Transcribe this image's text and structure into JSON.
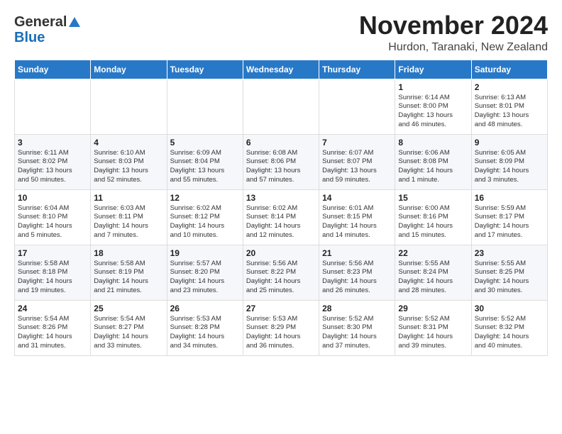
{
  "header": {
    "logo_general": "General",
    "logo_blue": "Blue",
    "month_title": "November 2024",
    "location": "Hurdon, Taranaki, New Zealand"
  },
  "days_of_week": [
    "Sunday",
    "Monday",
    "Tuesday",
    "Wednesday",
    "Thursday",
    "Friday",
    "Saturday"
  ],
  "weeks": [
    [
      {
        "day": "",
        "content": ""
      },
      {
        "day": "",
        "content": ""
      },
      {
        "day": "",
        "content": ""
      },
      {
        "day": "",
        "content": ""
      },
      {
        "day": "",
        "content": ""
      },
      {
        "day": "1",
        "content": "Sunrise: 6:14 AM\nSunset: 8:00 PM\nDaylight: 13 hours\nand 46 minutes."
      },
      {
        "day": "2",
        "content": "Sunrise: 6:13 AM\nSunset: 8:01 PM\nDaylight: 13 hours\nand 48 minutes."
      }
    ],
    [
      {
        "day": "3",
        "content": "Sunrise: 6:11 AM\nSunset: 8:02 PM\nDaylight: 13 hours\nand 50 minutes."
      },
      {
        "day": "4",
        "content": "Sunrise: 6:10 AM\nSunset: 8:03 PM\nDaylight: 13 hours\nand 52 minutes."
      },
      {
        "day": "5",
        "content": "Sunrise: 6:09 AM\nSunset: 8:04 PM\nDaylight: 13 hours\nand 55 minutes."
      },
      {
        "day": "6",
        "content": "Sunrise: 6:08 AM\nSunset: 8:06 PM\nDaylight: 13 hours\nand 57 minutes."
      },
      {
        "day": "7",
        "content": "Sunrise: 6:07 AM\nSunset: 8:07 PM\nDaylight: 13 hours\nand 59 minutes."
      },
      {
        "day": "8",
        "content": "Sunrise: 6:06 AM\nSunset: 8:08 PM\nDaylight: 14 hours\nand 1 minute."
      },
      {
        "day": "9",
        "content": "Sunrise: 6:05 AM\nSunset: 8:09 PM\nDaylight: 14 hours\nand 3 minutes."
      }
    ],
    [
      {
        "day": "10",
        "content": "Sunrise: 6:04 AM\nSunset: 8:10 PM\nDaylight: 14 hours\nand 5 minutes."
      },
      {
        "day": "11",
        "content": "Sunrise: 6:03 AM\nSunset: 8:11 PM\nDaylight: 14 hours\nand 7 minutes."
      },
      {
        "day": "12",
        "content": "Sunrise: 6:02 AM\nSunset: 8:12 PM\nDaylight: 14 hours\nand 10 minutes."
      },
      {
        "day": "13",
        "content": "Sunrise: 6:02 AM\nSunset: 8:14 PM\nDaylight: 14 hours\nand 12 minutes."
      },
      {
        "day": "14",
        "content": "Sunrise: 6:01 AM\nSunset: 8:15 PM\nDaylight: 14 hours\nand 14 minutes."
      },
      {
        "day": "15",
        "content": "Sunrise: 6:00 AM\nSunset: 8:16 PM\nDaylight: 14 hours\nand 15 minutes."
      },
      {
        "day": "16",
        "content": "Sunrise: 5:59 AM\nSunset: 8:17 PM\nDaylight: 14 hours\nand 17 minutes."
      }
    ],
    [
      {
        "day": "17",
        "content": "Sunrise: 5:58 AM\nSunset: 8:18 PM\nDaylight: 14 hours\nand 19 minutes."
      },
      {
        "day": "18",
        "content": "Sunrise: 5:58 AM\nSunset: 8:19 PM\nDaylight: 14 hours\nand 21 minutes."
      },
      {
        "day": "19",
        "content": "Sunrise: 5:57 AM\nSunset: 8:20 PM\nDaylight: 14 hours\nand 23 minutes."
      },
      {
        "day": "20",
        "content": "Sunrise: 5:56 AM\nSunset: 8:22 PM\nDaylight: 14 hours\nand 25 minutes."
      },
      {
        "day": "21",
        "content": "Sunrise: 5:56 AM\nSunset: 8:23 PM\nDaylight: 14 hours\nand 26 minutes."
      },
      {
        "day": "22",
        "content": "Sunrise: 5:55 AM\nSunset: 8:24 PM\nDaylight: 14 hours\nand 28 minutes."
      },
      {
        "day": "23",
        "content": "Sunrise: 5:55 AM\nSunset: 8:25 PM\nDaylight: 14 hours\nand 30 minutes."
      }
    ],
    [
      {
        "day": "24",
        "content": "Sunrise: 5:54 AM\nSunset: 8:26 PM\nDaylight: 14 hours\nand 31 minutes."
      },
      {
        "day": "25",
        "content": "Sunrise: 5:54 AM\nSunset: 8:27 PM\nDaylight: 14 hours\nand 33 minutes."
      },
      {
        "day": "26",
        "content": "Sunrise: 5:53 AM\nSunset: 8:28 PM\nDaylight: 14 hours\nand 34 minutes."
      },
      {
        "day": "27",
        "content": "Sunrise: 5:53 AM\nSunset: 8:29 PM\nDaylight: 14 hours\nand 36 minutes."
      },
      {
        "day": "28",
        "content": "Sunrise: 5:52 AM\nSunset: 8:30 PM\nDaylight: 14 hours\nand 37 minutes."
      },
      {
        "day": "29",
        "content": "Sunrise: 5:52 AM\nSunset: 8:31 PM\nDaylight: 14 hours\nand 39 minutes."
      },
      {
        "day": "30",
        "content": "Sunrise: 5:52 AM\nSunset: 8:32 PM\nDaylight: 14 hours\nand 40 minutes."
      }
    ]
  ]
}
